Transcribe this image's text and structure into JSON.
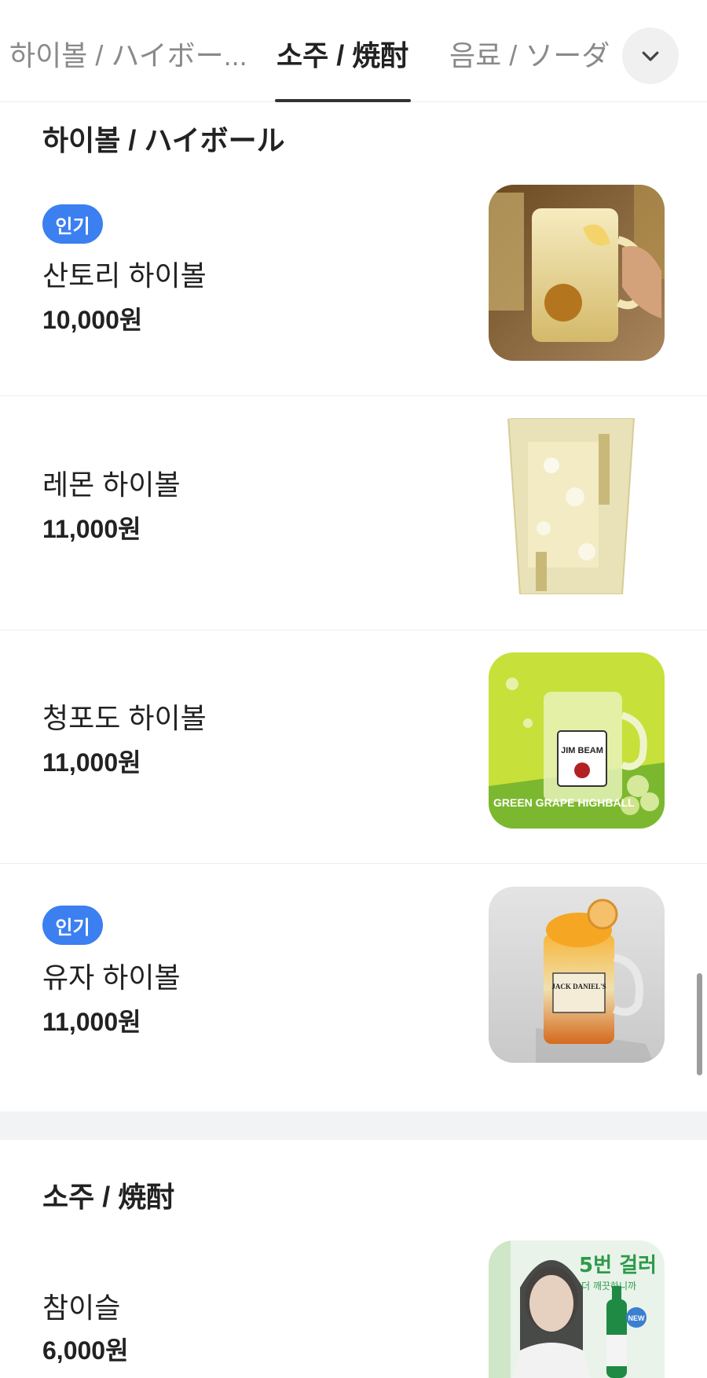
{
  "tabs": [
    {
      "label": "하이볼 / ハイボー..."
    },
    {
      "label": "소주 / 焼酎"
    },
    {
      "label": "음료 / ソーダ"
    }
  ],
  "active_tab_index": 1,
  "icons": {
    "expand": "chevron-down-icon"
  },
  "sections": [
    {
      "title": "하이볼 / ハイボール",
      "items": [
        {
          "badge": "인기",
          "name": "산토리 하이볼",
          "price": "10,000원",
          "image": "suntory-highball-image"
        },
        {
          "badge": "",
          "name": "레몬 하이볼",
          "price": "11,000원",
          "image": "lemon-highball-image"
        },
        {
          "badge": "",
          "name": "청포도 하이볼",
          "price": "11,000원",
          "image": "green-grape-highball-image"
        },
        {
          "badge": "인기",
          "name": "유자 하이볼",
          "price": "11,000원",
          "image": "yuzu-highball-image"
        }
      ]
    },
    {
      "title": "소주 / 焼酎",
      "items": [
        {
          "badge": "",
          "name": "참이슬",
          "price": "6,000원",
          "image": "chamisul-soju-image"
        }
      ]
    }
  ],
  "image_text": {
    "grape_highball": "GREEN GRAPE HIGHBALL",
    "jim_beam": "JIM BEAM",
    "jack_daniels": "JACK DANIEL'S",
    "chamisul_ad_big": "5번 걸러",
    "chamisul_ad_small": "더 깨끗하니까",
    "chamisul_ad_new": "NEW"
  },
  "colors": {
    "badge": "#3b7ff0",
    "active_tab_underline": "#333333",
    "section_gap": "#f2f3f5"
  }
}
